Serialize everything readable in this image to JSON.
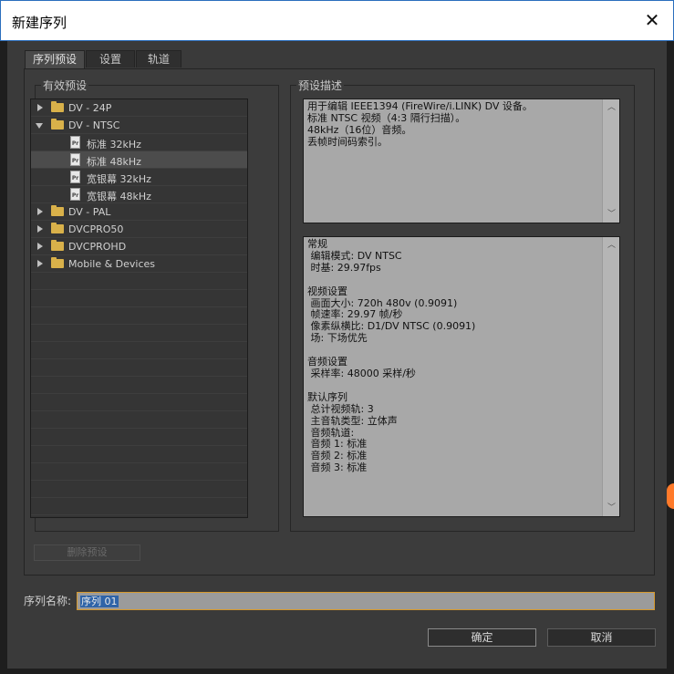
{
  "window": {
    "title": "新建序列"
  },
  "tabs": [
    "序列预设",
    "设置",
    "轨道"
  ],
  "presets": {
    "group_label": "有效预设",
    "items": [
      {
        "type": "folder",
        "label": "DV - 24P",
        "expanded": false,
        "depth": 0
      },
      {
        "type": "folder",
        "label": "DV - NTSC",
        "expanded": true,
        "depth": 0
      },
      {
        "type": "preset",
        "label": "标准 32kHz",
        "depth": 1
      },
      {
        "type": "preset",
        "label": "标准 48kHz",
        "depth": 1,
        "selected": true
      },
      {
        "type": "preset",
        "label": "宽银幕 32kHz",
        "depth": 1
      },
      {
        "type": "preset",
        "label": "宽银幕 48kHz",
        "depth": 1
      },
      {
        "type": "folder",
        "label": "DV - PAL",
        "expanded": false,
        "depth": 0
      },
      {
        "type": "folder",
        "label": "DVCPRO50",
        "expanded": false,
        "depth": 0
      },
      {
        "type": "folder",
        "label": "DVCPROHD",
        "expanded": false,
        "depth": 0
      },
      {
        "type": "folder",
        "label": "Mobile & Devices",
        "expanded": false,
        "depth": 0
      }
    ],
    "file_icon_text": "Pr"
  },
  "description": {
    "group_label": "预设描述",
    "summary_text": "用于编辑 IEEE1394 (FireWire/i.LINK) DV 设备。\n标准 NTSC 视频（4:3 隔行扫描）。\n48kHz（16位）音频。\n丢帧时间码索引。",
    "details_text": "常规\n 编辑模式: DV NTSC\n 时基: 29.97fps\n\n视频设置\n 画面大小: 720h 480v (0.9091)\n 帧速率: 29.97 帧/秒\n 像素纵横比: D1/DV NTSC (0.9091)\n 场: 下场优先\n\n音频设置\n 采样率: 48000 采样/秒\n\n默认序列\n 总计视频轨: 3\n 主音轨类型: 立体声\n 音频轨道:\n 音频 1: 标准\n 音频 2: 标准\n 音频 3: 标准"
  },
  "delete_preset_label": "删除预设",
  "sequence_name": {
    "label": "序列名称:",
    "value": "序列 01"
  },
  "buttons": {
    "ok": "确定",
    "cancel": "取消"
  },
  "colors": {
    "accent_focus": "#d79a2e",
    "selection": "#2f64a8",
    "folder": "#d9b14a"
  }
}
